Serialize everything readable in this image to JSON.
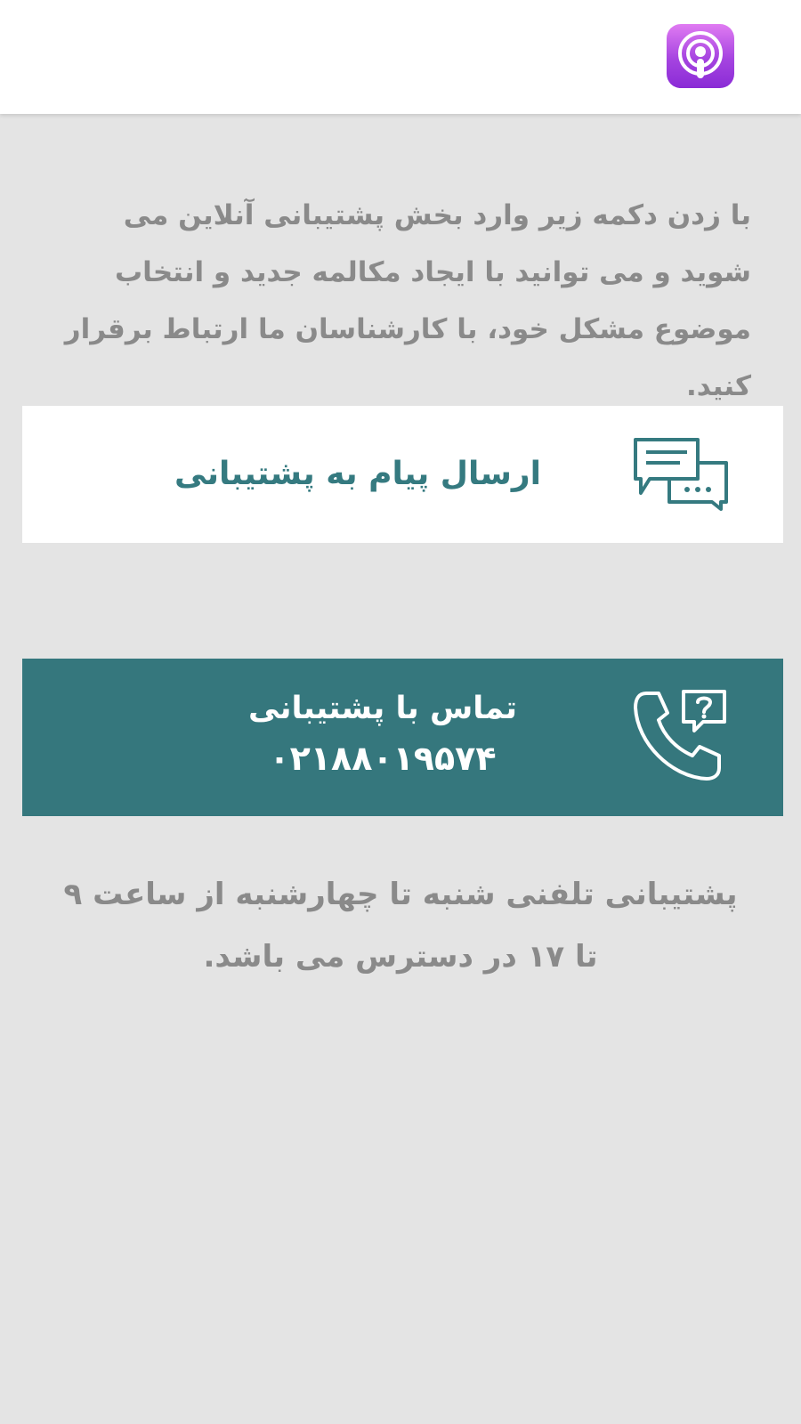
{
  "header": {
    "app_icon": "podcasts-icon",
    "app_icon_color": "#a544e0"
  },
  "intro": {
    "text": "با زدن دکمه زیر وارد بخش پشتیبانی آنلاین می شوید و می توانید با ایجاد مکالمه جدید و انتخاب موضوع مشکل خود، با کارشناسان ما ارتباط برقرار کنید."
  },
  "message_support": {
    "label": "ارسال پیام به پشتیبانی",
    "icon": "chat-bubbles-icon",
    "color": "#357a80"
  },
  "call_support": {
    "title": "تماس با پشتیبانی",
    "phone": "۰۲۱۸۸۰۱۹۵۷۴",
    "icon": "phone-question-icon",
    "background": "#35777d"
  },
  "hours": {
    "text": "پشتیبانی تلفنی شنبه تا چهارشنبه از ساعت ۹ تا ۱۷ در دسترس می باشد."
  }
}
